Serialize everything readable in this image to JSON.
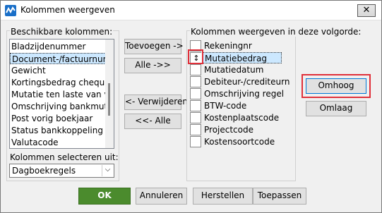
{
  "window": {
    "title": "Kolommen weergeven",
    "close_glyph": "✕"
  },
  "available": {
    "label": "Beschikbare kolommen:",
    "items": [
      "Bladzijdenummer",
      "Document-/factuurnum",
      "Gewicht",
      "Kortingsbedrag cheque-",
      "Mutatie ten laste van vrij",
      "Omschrijving bankmuta",
      "Post vorig boekjaar",
      "Status bankkoppeling",
      "Valutacode"
    ],
    "selected_index": 1
  },
  "select_from": {
    "label": "Kolommen selecteren uit:",
    "value": "Dagboekregels",
    "arrow": "⌵"
  },
  "middle_buttons": {
    "add": "Toevoegen ->",
    "add_all": "Alle ->>",
    "remove": "<- Verwijderen",
    "remove_all": "<<- Alle"
  },
  "shown": {
    "label": "Kolommen weergeven in deze volgorde:",
    "items": [
      "Rekeningnr",
      "Mutatiebedrag",
      "Mutatiedatum",
      "Debiteur-/crediteurn",
      "Omschrijving regel",
      "BTW-code",
      "Kostenplaatscode",
      "Projectcode",
      "Kostensoortcode"
    ],
    "selected_index": 1,
    "updown_glyph": "↕"
  },
  "order_buttons": {
    "up": "Omhoog",
    "down": "Omlaag"
  },
  "footer": {
    "ok": "OK",
    "cancel": "Annuleren",
    "reset": "Herstellen",
    "apply": "Toepassen"
  }
}
